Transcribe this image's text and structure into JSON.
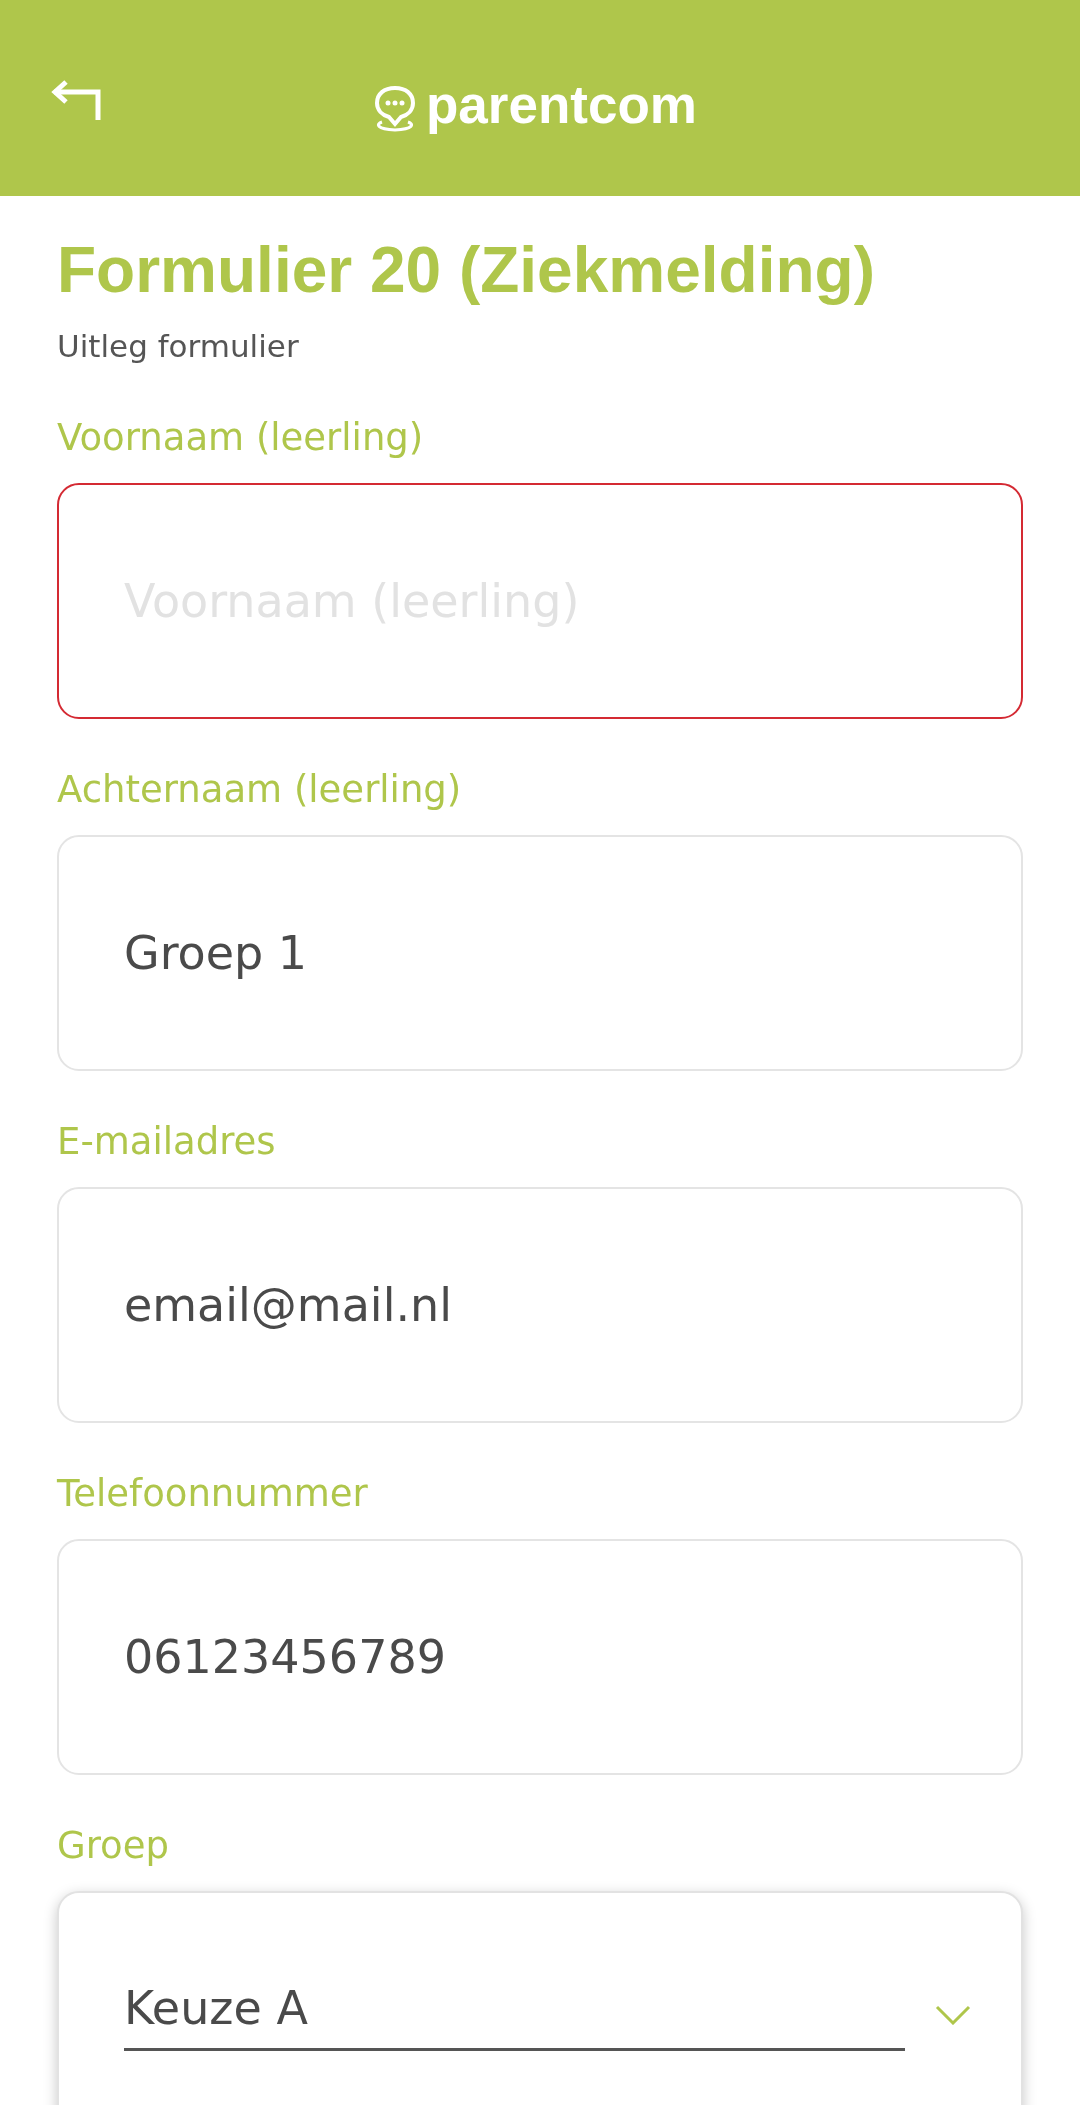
{
  "header": {
    "logo_text": "parentcom"
  },
  "form": {
    "title": "Formulier 20 (Ziekmelding)",
    "description": "Uitleg formulier",
    "fields": [
      {
        "kind": "text",
        "label": "Voornaam (leerling)",
        "placeholder": "Voornaam (leerling)",
        "invalid": true
      },
      {
        "kind": "text",
        "label": "Achternaam (leerling)",
        "value": "Groep 1",
        "invalid": false
      },
      {
        "kind": "text",
        "label": "E-mailadres",
        "value": "email@mail.nl",
        "invalid": false
      },
      {
        "kind": "text",
        "label": "Telefoonnummer",
        "value": "06123456789",
        "invalid": false
      },
      {
        "kind": "select",
        "label": "Groep",
        "value": "Keuze A"
      }
    ]
  }
}
